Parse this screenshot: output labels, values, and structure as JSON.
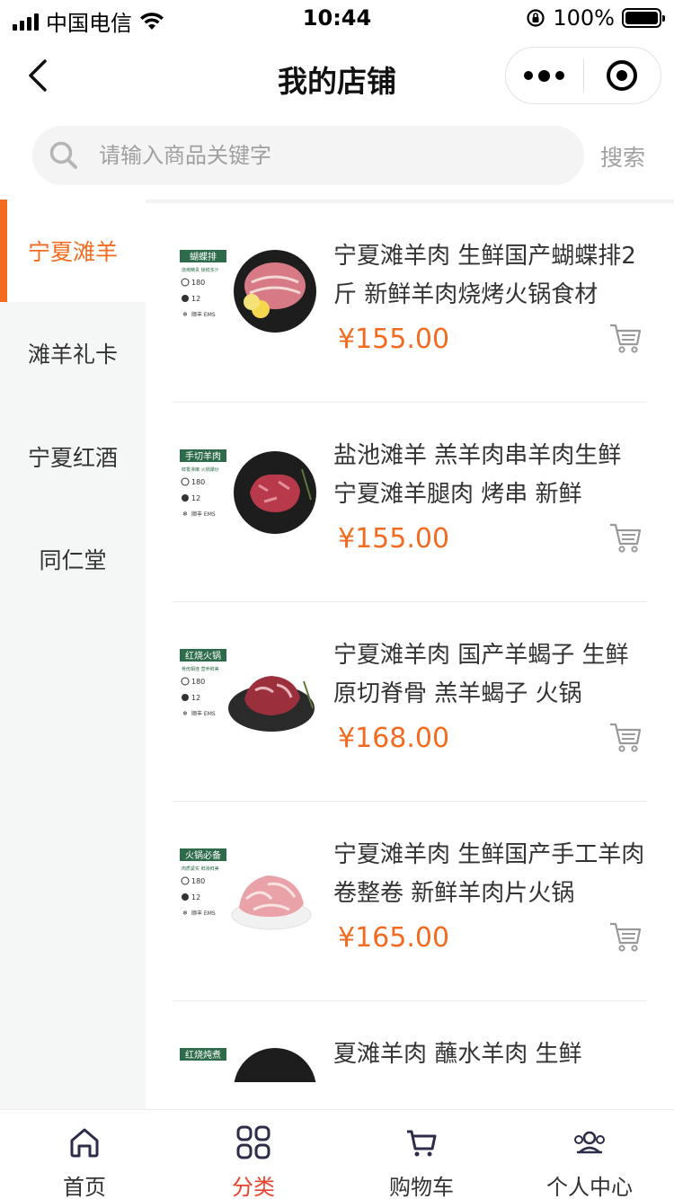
{
  "status_bar": {
    "carrier": "中国电信",
    "time": "10:44",
    "battery": "100%"
  },
  "nav": {
    "title": "我的店铺"
  },
  "search": {
    "placeholder": "请输入商品关键字",
    "value": "",
    "button_label": "搜索"
  },
  "sidebar": {
    "items": [
      {
        "label": "宁夏滩羊",
        "active": true
      },
      {
        "label": "滩羊礼卡",
        "active": false
      },
      {
        "label": "宁夏红酒",
        "active": false
      },
      {
        "label": "同仁堂",
        "active": false
      }
    ]
  },
  "products": [
    {
      "name": "宁夏滩羊肉 生鲜国产蝴蝶排2斤 新鲜羊肉烧烤火锅食材",
      "price": "¥155.00",
      "tag": "蝴蝶排",
      "sub": "烧烤精贵 锁鲜多汁"
    },
    {
      "name": "盐池滩羊 羔羊肉串羊肉生鲜 宁夏滩羊腿肉 烤串 新鲜",
      "price": "¥155.00",
      "tag": "手切羊肉",
      "sub": "鲜香滑嫩 火锅爆炒"
    },
    {
      "name": "宁夏滩羊肉 国产羊蝎子 生鲜 原切脊骨 羔羊蝎子 火锅",
      "price": "¥168.00",
      "tag": "红烧火锅",
      "sub": "骨肉相连 营养鲜美"
    },
    {
      "name": "宁夏滩羊肉 生鲜国产手工羊肉卷整卷 新鲜羊肉片火锅",
      "price": "¥165.00",
      "tag": "火锅必备",
      "sub": "肉质紧实 鲜滑鲜美"
    },
    {
      "name": "夏滩羊肉 蘸水羊肉 生鲜",
      "price": "",
      "tag": "红烧炖煮",
      "sub": ""
    }
  ],
  "product_badge": {
    "days": "180",
    "days_note": "天无添加",
    "hours": "12",
    "hours_note": "小时",
    "shipping": "顺丰 EMS"
  },
  "tabbar": {
    "items": [
      {
        "label": "首页",
        "active": false
      },
      {
        "label": "分类",
        "active": true
      },
      {
        "label": "购物车",
        "active": false
      },
      {
        "label": "个人中心",
        "active": false
      }
    ]
  },
  "colors": {
    "accent": "#f26b20",
    "tab_active": "#e8412c",
    "sidebar_bg": "#f5f6f6",
    "badge_green": "#2e6b4a"
  }
}
